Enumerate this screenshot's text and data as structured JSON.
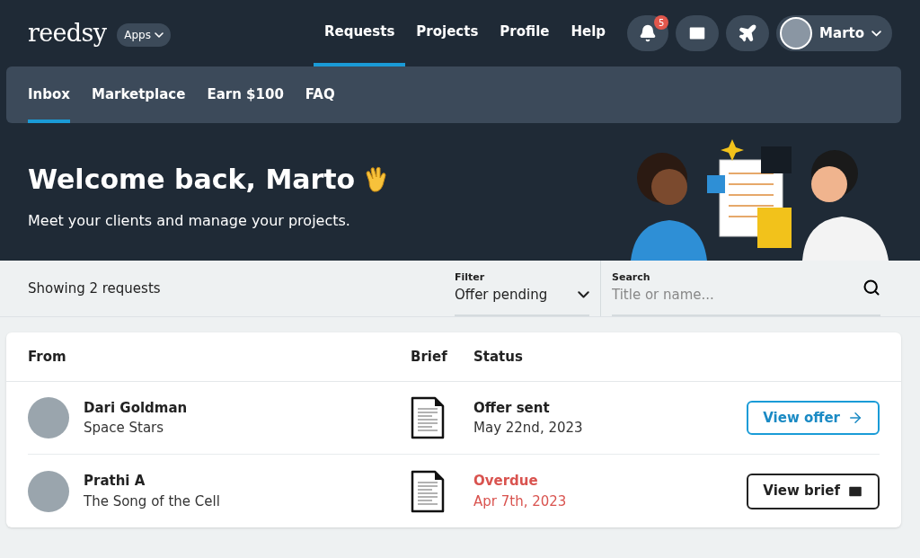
{
  "brand": {
    "logo": "reedsy",
    "apps_button": "Apps"
  },
  "nav": [
    {
      "label": "Requests",
      "selected": true
    },
    {
      "label": "Projects",
      "selected": false
    },
    {
      "label": "Profile",
      "selected": false
    },
    {
      "label": "Help",
      "selected": false
    }
  ],
  "notifications": {
    "count": "5"
  },
  "user": {
    "name": "Marto"
  },
  "subnav": [
    {
      "label": "Inbox",
      "selected": true
    },
    {
      "label": "Marketplace",
      "selected": false
    },
    {
      "label": "Earn $100",
      "selected": false
    },
    {
      "label": "FAQ",
      "selected": false
    }
  ],
  "hero": {
    "title": "Welcome back, Marto",
    "subtitle": "Meet your clients and manage your projects."
  },
  "toolbar": {
    "summary": "Showing 2 requests",
    "filter": {
      "label": "Filter",
      "value": "Offer pending"
    },
    "search": {
      "label": "Search",
      "placeholder": "Title or name..."
    }
  },
  "table": {
    "columns": [
      "From",
      "Brief",
      "Status"
    ],
    "rows": [
      {
        "name": "Dari Goldman",
        "project": "Space Stars",
        "status": "Offer sent",
        "date": "May 22nd, 2023",
        "overdue": false,
        "action": {
          "label": "View offer",
          "kind": "offer"
        }
      },
      {
        "name": "Prathi A",
        "project": "The Song of the Cell",
        "status": "Overdue",
        "date": "Apr 7th, 2023",
        "overdue": true,
        "action": {
          "label": "View brief",
          "kind": "brief"
        }
      }
    ]
  }
}
